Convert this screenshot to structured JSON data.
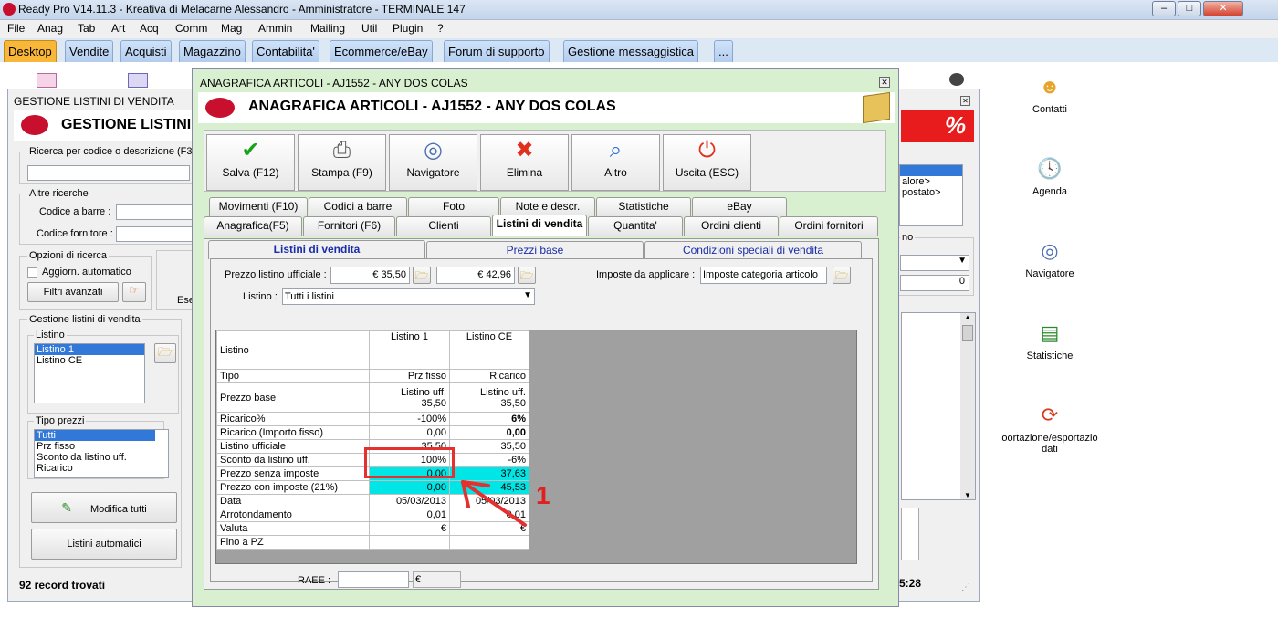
{
  "app": {
    "title": "Ready Pro V14.11.3 - Kreativa di Melacarne Alessandro - Amministratore - TERMINALE 147",
    "window_buttons": [
      "–",
      "□",
      "✕"
    ]
  },
  "menu": [
    "File",
    "Anag",
    "Tab",
    "Art",
    "Acq",
    "Comm",
    "Mag",
    "Ammin",
    "Mailing",
    "Util",
    "Plugin",
    "?"
  ],
  "main_tabs": [
    "Desktop",
    "Vendite",
    "Acquisti",
    "Magazzino",
    "Contabilita'",
    "Ecommerce/eBay",
    "Forum di supporto",
    "Gestione messaggistica",
    "..."
  ],
  "desktop_icons": [
    "Contatti",
    "Agenda",
    "Navigatore",
    "Statistiche",
    "oortazione/esportazio dati"
  ],
  "bg_window": {
    "title": "GESTIONE LISTINI DI VENDITA",
    "heading": "GESTIONE LISTINI",
    "search_label": "Ricerca per codice o descrizione (F3)",
    "other_search": "Altre ricerche",
    "barcode_label": "Codice a barre :",
    "supplier_label": "Codice fornitore :",
    "options_label": "Opzioni di ricerca",
    "auto_update": "Aggiorn. automatico",
    "advanced_filters": "Filtri avanzati",
    "ese_label": "Ese",
    "listini_group": "Gestione listini di vendita",
    "listino_label": "Listino",
    "listini": [
      "Listino 1",
      "Listino CE"
    ],
    "tipo_prezzi_label": "Tipo prezzi",
    "tipo_prezzi": [
      "Tutti",
      "Prz fisso",
      "Sconto da listino uff.",
      "Ricarico"
    ],
    "modifica_tutti": "Modifica tutti",
    "listini_automatici": "Listini automatici",
    "records": "92 record trovati",
    "right_list": [
      "alore>",
      "postato>"
    ],
    "right_group": "no",
    "right_value": "0",
    "time": "5:28",
    "percent": "%"
  },
  "dialog": {
    "title": "ANAGRAFICA ARTICOLI - AJ1552 - ANY DOS COLAS",
    "heading": "ANAGRAFICA ARTICOLI - AJ1552 - ANY DOS COLAS",
    "toolbar": [
      {
        "label": "Salva (F12)",
        "icon": "✔",
        "color": "#1aa31a"
      },
      {
        "label": "Stampa (F9)",
        "icon": "⎙",
        "color": "#555"
      },
      {
        "label": "Navigatore",
        "icon": "◎",
        "color": "#4a6fb0"
      },
      {
        "label": "Elimina",
        "icon": "✖",
        "color": "#e0301e"
      },
      {
        "label": "Altro",
        "icon": "⌕",
        "color": "#2a6ad0"
      },
      {
        "label": "Uscita (ESC)",
        "icon": "⏻",
        "color": "#e0301e"
      }
    ],
    "tabs_row1": [
      "Movimenti (F10)",
      "Codici a barre",
      "Foto",
      "Note e descr.",
      "Statistiche",
      "eBay"
    ],
    "tabs_row2": [
      "Anagrafica(F5)",
      "Fornitori (F6)",
      "Clienti",
      "Listini di vendita",
      "Quantita'",
      "Ordini clienti",
      "Ordini fornitori"
    ],
    "subtabs": [
      "Listini di vendita",
      "Prezzi base",
      "Condizioni speciali di vendita"
    ],
    "prezzo_label": "Prezzo listino ufficiale :",
    "prezzo1": "€ 35,50",
    "prezzo2": "€ 42,96",
    "imposte_label": "Imposte da applicare :",
    "imposte_value": "Imposte categoria articolo",
    "listino_label": "Listino :",
    "listino_value": "Tutti i listini",
    "grid_headers": [
      "Listino",
      "Listino 1",
      "Listino CE"
    ],
    "grid_rows": [
      [
        "Tipo",
        "Prz fisso",
        "Ricarico"
      ],
      [
        "Prezzo base",
        "Listino uff.\n35,50",
        "Listino uff.\n35,50"
      ],
      [
        "Ricarico%",
        "-100%",
        "6%"
      ],
      [
        "Ricarico (Importo fisso)",
        "0,00",
        "0,00"
      ],
      [
        "Listino ufficiale",
        "35,50",
        "35,50"
      ],
      [
        "Sconto da listino uff.",
        "100%",
        "-6%"
      ],
      [
        "Prezzo senza imposte",
        "0,00",
        "37,63"
      ],
      [
        "Prezzo con imposte (21%)",
        "0,00",
        "45,53"
      ],
      [
        "Data",
        "05/03/2013",
        "05/03/2013"
      ],
      [
        "Arrotondamento",
        "0,01",
        "0,01"
      ],
      [
        "Valuta",
        "€",
        "€"
      ],
      [
        "Fino a PZ",
        "",
        ""
      ]
    ],
    "raee_label": "RAEE :",
    "raee_currency": "€",
    "annotation_number": "1"
  }
}
